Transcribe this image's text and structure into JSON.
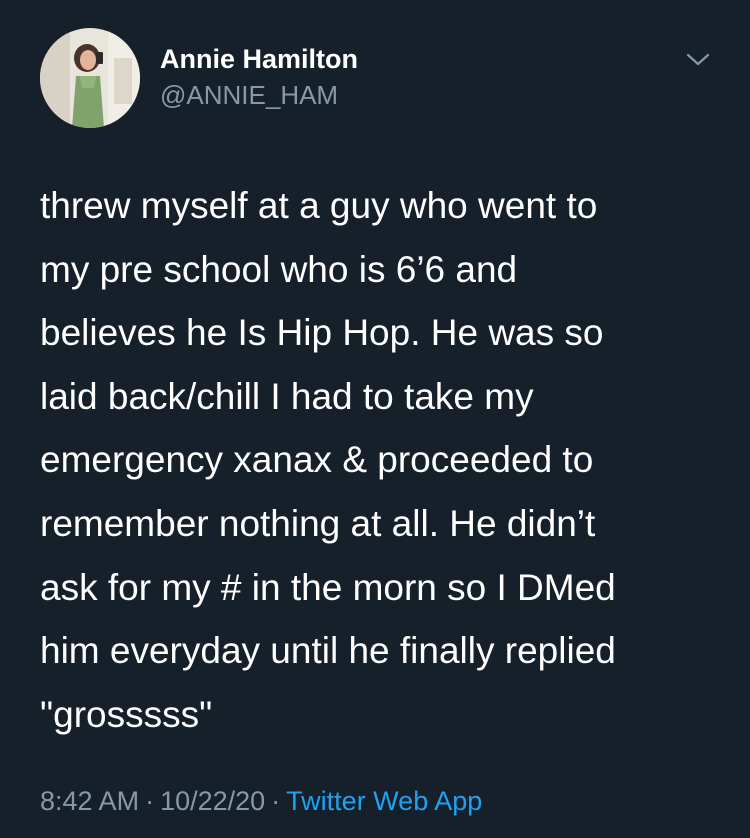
{
  "colors": {
    "background": "#15202b",
    "primary_text": "#ffffff",
    "secondary_text": "#8899a6",
    "link": "#1da1f2"
  },
  "tweet": {
    "author": {
      "display_name": "Annie Hamilton",
      "handle": "@ANNIE_HAM",
      "avatar_icon": "profile-photo-avatar"
    },
    "menu_icon": "chevron-down-icon",
    "text_lines": [
      "threw myself at a guy who went to",
      "my pre school who is 6’6 and",
      "believes he Is Hip Hop. He was so",
      "laid back/chill I had to take my",
      "emergency xanax & proceeded to",
      "remember nothing at all. He didn’t",
      "ask for my # in the morn so I DMed",
      "him everyday until he finally replied",
      "\"grosssss\""
    ],
    "time": "8:42 AM",
    "separator": "·",
    "date": "10/22/20",
    "source": "Twitter Web App"
  }
}
